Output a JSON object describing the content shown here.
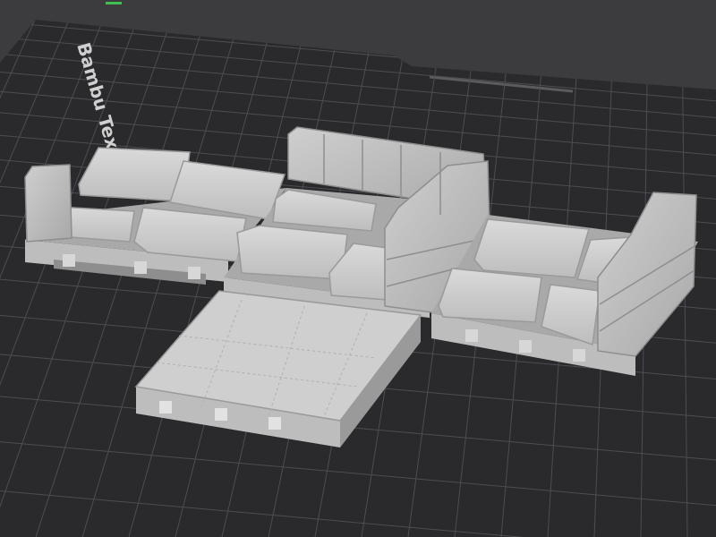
{
  "viewport": {
    "bed_label": "Bambu Textu",
    "colors": {
      "background": "#3c3c3f",
      "plate": "#2a2a2d",
      "grid": "#4d4d52",
      "model_light": "#d2d2d2",
      "model_mid": "#b9b9b9",
      "model_dark": "#8e8e8e",
      "indicator": "#3fbf52"
    }
  }
}
